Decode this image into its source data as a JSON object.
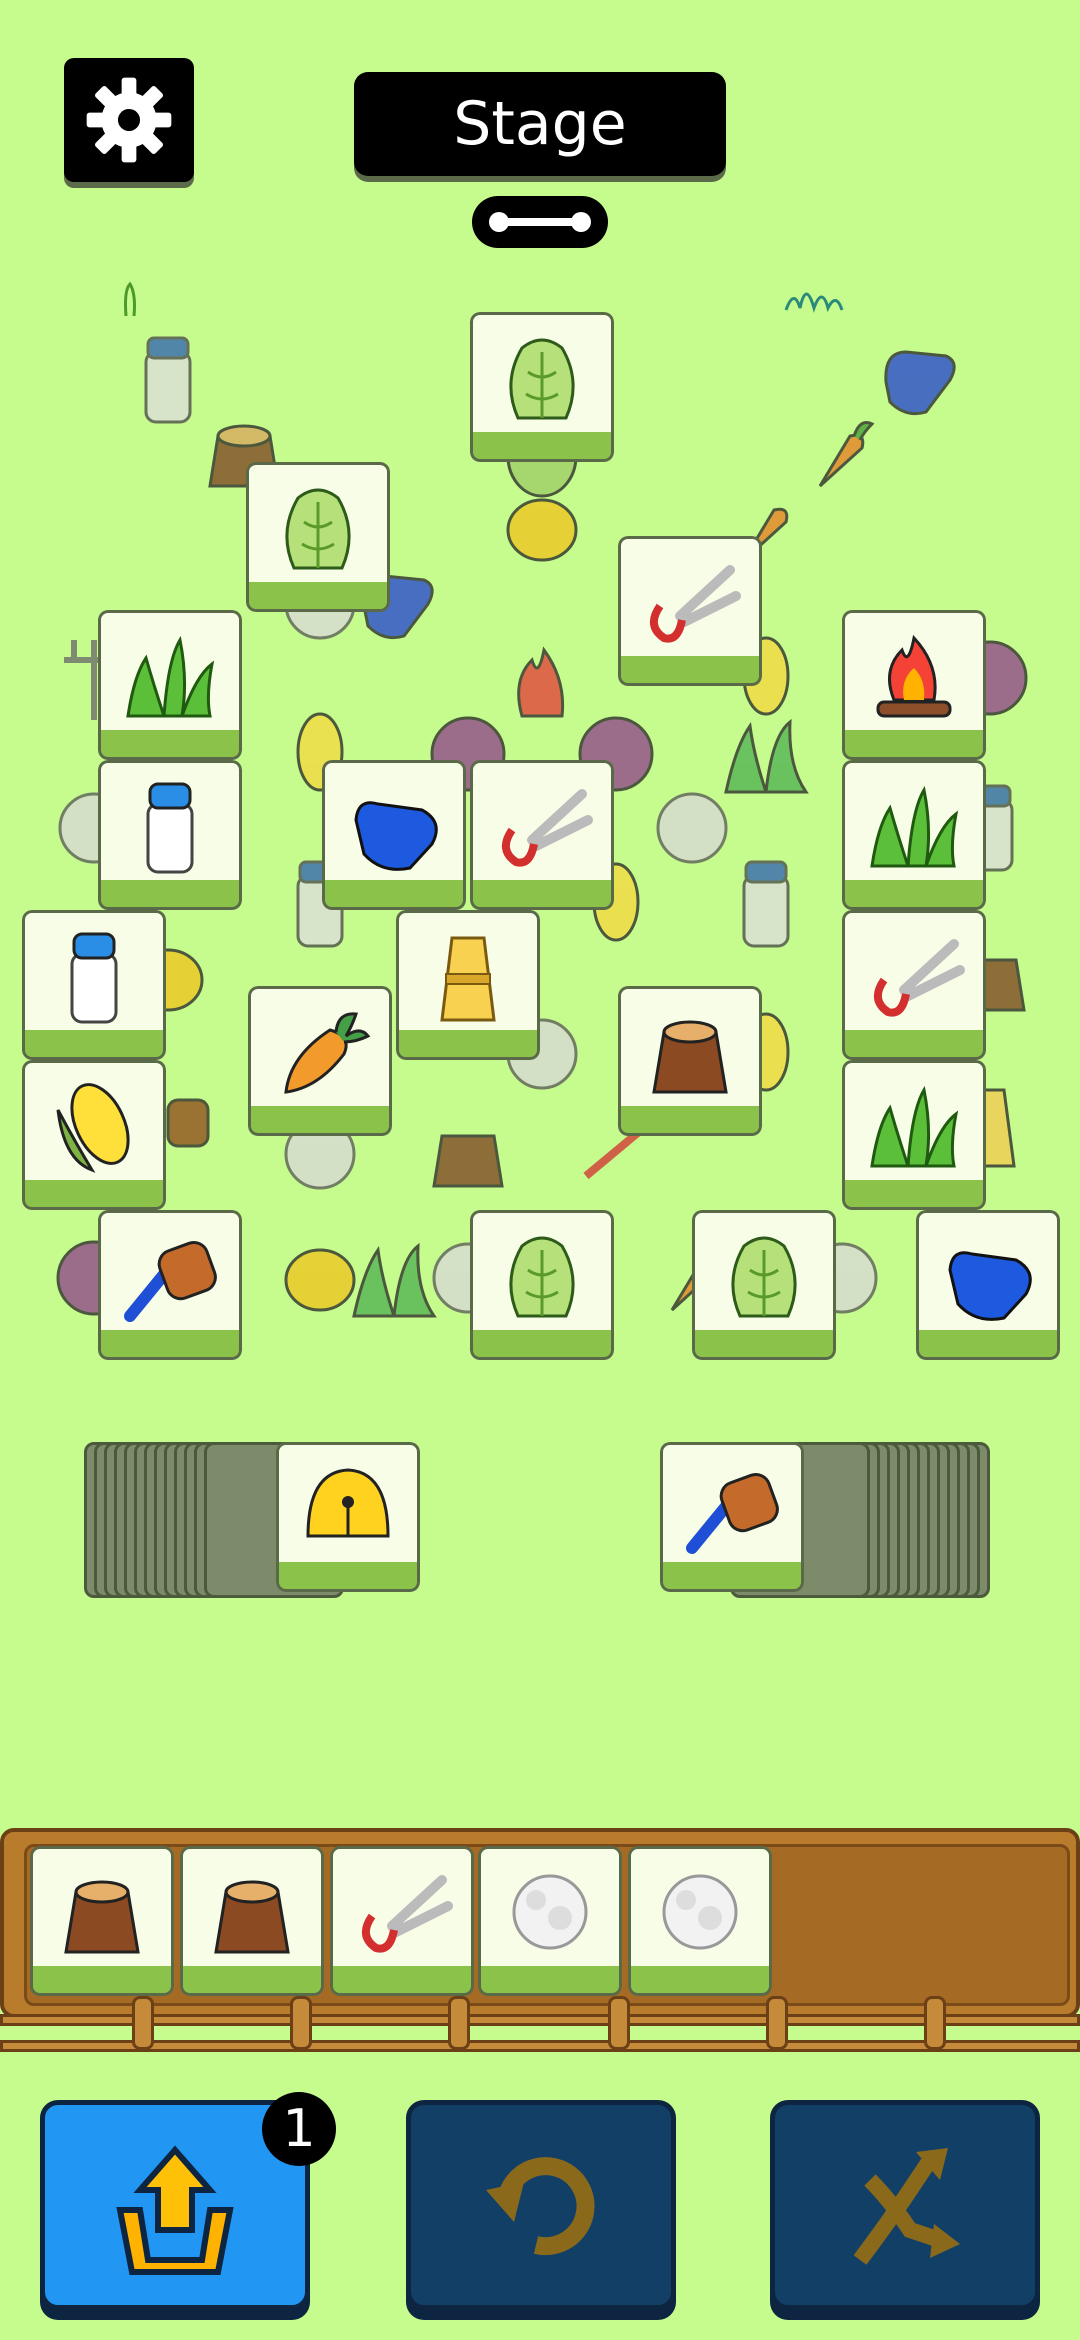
{
  "header": {
    "settings_icon": "gear-icon",
    "stage_label": "Stage",
    "progress_icon": "link-progress-icon"
  },
  "board": {
    "lower_tiles": [
      {
        "icon": "milk-jug-icon"
      },
      {
        "icon": "tree-stump-icon"
      },
      {
        "icon": "glove-icon"
      },
      {
        "icon": "carrot-icon"
      },
      {
        "icon": "pitchfork-icon"
      },
      {
        "icon": "yarn-ball-icon"
      },
      {
        "icon": "corn-icon"
      },
      {
        "icon": "wool-icon"
      },
      {
        "icon": "fire-icon"
      },
      {
        "icon": "grass-icon"
      },
      {
        "icon": "hay-bundle-icon"
      },
      {
        "icon": "bell-icon"
      }
    ],
    "top_tiles": [
      {
        "icon": "cabbage-icon"
      },
      {
        "icon": "cabbage-icon"
      },
      {
        "icon": "shears-icon"
      },
      {
        "icon": "grass-icon"
      },
      {
        "icon": "campfire-icon"
      },
      {
        "icon": "milk-jug-icon"
      },
      {
        "icon": "glove-icon"
      },
      {
        "icon": "shears-icon"
      },
      {
        "icon": "grass-icon"
      },
      {
        "icon": "milk-jug-icon"
      },
      {
        "icon": "hay-bundle-icon"
      },
      {
        "icon": "shears-icon"
      },
      {
        "icon": "carrot-icon"
      },
      {
        "icon": "tree-stump-icon"
      },
      {
        "icon": "corn-icon"
      },
      {
        "icon": "grass-icon"
      },
      {
        "icon": "brush-icon"
      },
      {
        "icon": "cabbage-icon"
      },
      {
        "icon": "cabbage-icon"
      },
      {
        "icon": "glove-icon"
      }
    ]
  },
  "stacks": {
    "left": {
      "top_icon": "bell-icon"
    },
    "right": {
      "top_icon": "brush-icon"
    }
  },
  "tray": {
    "slots": [
      {
        "icon": "tree-stump-icon"
      },
      {
        "icon": "tree-stump-icon"
      },
      {
        "icon": "shears-icon"
      },
      {
        "icon": "wool-icon"
      },
      {
        "icon": "wool-icon"
      }
    ],
    "capacity": 7
  },
  "powerups": [
    {
      "name": "undo-tiles",
      "icon": "box-arrow-up-icon",
      "count": "1",
      "color": "#2196f3"
    },
    {
      "name": "undo",
      "icon": "undo-arrow-icon",
      "color": "#123f66"
    },
    {
      "name": "shuffle",
      "icon": "shuffle-icon",
      "color": "#123f66"
    }
  ]
}
